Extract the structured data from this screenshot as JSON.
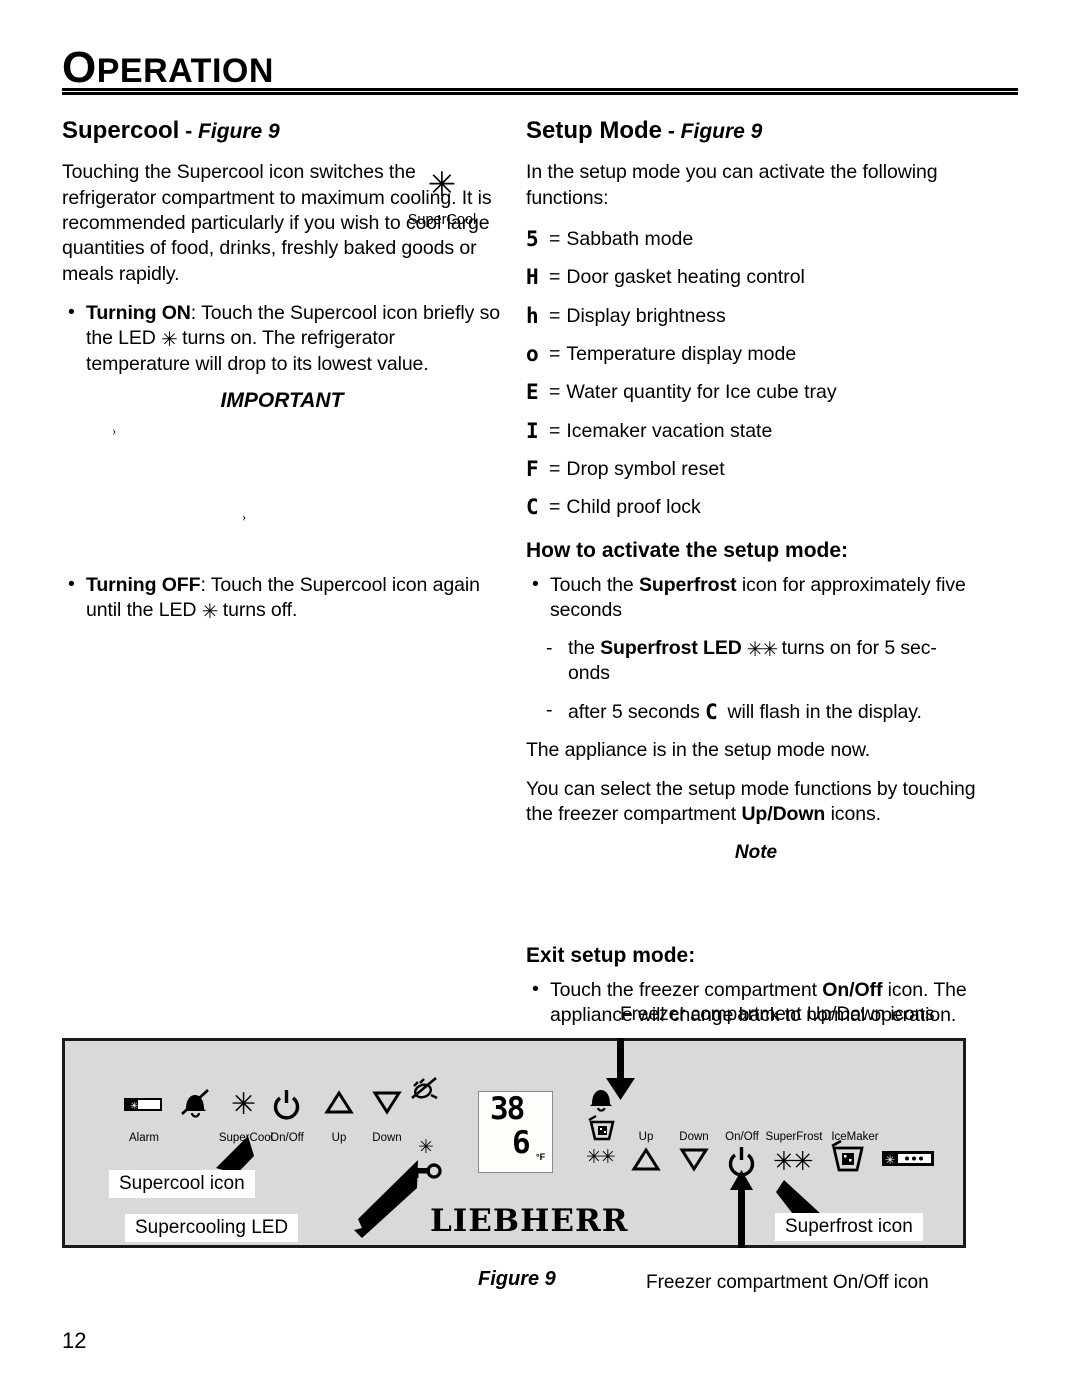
{
  "header": {
    "title_cap": "O",
    "title_rest": "PERATION"
  },
  "left": {
    "heading": "Supercool",
    "heading_dash": " - ",
    "heading_fig": "Figure 9",
    "intro": "Touching the Supercool icon switches the refrigerator compartment to maximum cooling. It is recommended particularly if you wish to cool large quantities of food, drinks, freshly baked goods or meals rapidly.",
    "bullet_on_label": "Turning ON",
    "bullet_on_text_a": ": Touch the Supercool icon briefly so the LED ",
    "bullet_on_text_b": " turns on. The refrigerator temperature will drop to its lowest value.",
    "side_icon": "supercool-asterisk-icon",
    "side_icon_glyph": "✳",
    "side_caption": "SuperCool",
    "important": "IMPORTANT",
    "stray_mark_1": "›",
    "stray_mark_2": "›",
    "bullet_off_label": "Turning OFF",
    "bullet_off_text_a": ": Touch the Supercool icon again until the LED ",
    "bullet_off_text_b": " turns off."
  },
  "right": {
    "heading": "Setup Mode",
    "heading_dash": " - ",
    "heading_fig": "Figure 9",
    "intro": "In the setup mode you can activate the following functions:",
    "functions": [
      {
        "glyph": "5",
        "eq": "=",
        "label": "Sabbath mode"
      },
      {
        "glyph": "H",
        "eq": "=",
        "label": "Door gasket heating control"
      },
      {
        "glyph": "h",
        "eq": "=",
        "label": "Display brightness"
      },
      {
        "glyph": "o",
        "eq": "=",
        "label": "Temperature display mode"
      },
      {
        "glyph": "E",
        "eq": "=",
        "label": "Water quantity for Ice cube tray"
      },
      {
        "glyph": "I",
        "eq": "=",
        "label": "Icemaker vacation state"
      },
      {
        "glyph": "F",
        "eq": "=",
        "label": "Drop symbol reset"
      },
      {
        "glyph": "C",
        "eq": "=",
        "label": "Child proof lock"
      }
    ],
    "activate_heading": "How to activate the setup mode:",
    "activate_bullet_a": "Touch the ",
    "activate_bullet_b": "Superfrost",
    "activate_bullet_c": " icon for approximately five seconds",
    "dash1_a": "the ",
    "dash1_b": "Superfrost LED",
    "dash1_c": " turns on for 5 sec-onds",
    "dash1_c_line1": " turns on for 5 sec-",
    "dash1_c_line2": "onds",
    "dash2_a": "after 5 seconds ",
    "dash2_glyph": "C",
    "dash2_b": " will flash in the display.",
    "para_now": "The appliance is in the setup mode now.",
    "para_select_a": "You can select the setup mode functions by touching the freezer compartment ",
    "para_select_b": "Up/Down",
    "para_select_c": " icons.",
    "note": "Note",
    "exit_heading": "Exit setup mode:",
    "exit_bullet_a": "Touch the freezer compartment ",
    "exit_bullet_b": "On/Off",
    "exit_bullet_c": " icon. The appliance will change back to normal operation."
  },
  "figure": {
    "top_label": "Freezer compartment Up/Down icons",
    "bottom_label": "Freezer compartment On/Off icon",
    "caption": "Figure 9",
    "brand": "LIEBHERR",
    "callout_supercool_icon": "Supercool icon",
    "callout_supercooling_led": "Supercooling LED",
    "callout_superfrost_icon": "Superfrost icon",
    "left_labels": [
      "Alarm",
      "SuperCool",
      "On/Off",
      "Up",
      "Down"
    ],
    "right_labels": [
      "Up",
      "Down",
      "On/Off",
      "SuperFrost",
      "IceMaker"
    ],
    "lcd_top": "38",
    "lcd_bottom": "6",
    "lcd_unit": "°F",
    "icons": {
      "fridge_bar": "fridge-compartment-bar-icon",
      "alarm": "alarm-bell-crossed-icon",
      "supercool": "✳",
      "onoff": "⏻",
      "up": "△",
      "down": "▽",
      "plug_off": "plug-crossed-icon",
      "supercool_led": "✳",
      "key": "key-icon",
      "bell": "bell-icon",
      "icecube": "ice-cube-tray-icon",
      "superfrost_led": "✳✳",
      "up_r": "△",
      "down_r": "▽",
      "onoff_r": "⏻",
      "superfrost": "✳✳",
      "icemaker": "ice-cube-tray-icon",
      "freezer_bar": "freezer-compartment-bar-icon"
    }
  },
  "footer": {
    "page_number": "12"
  }
}
